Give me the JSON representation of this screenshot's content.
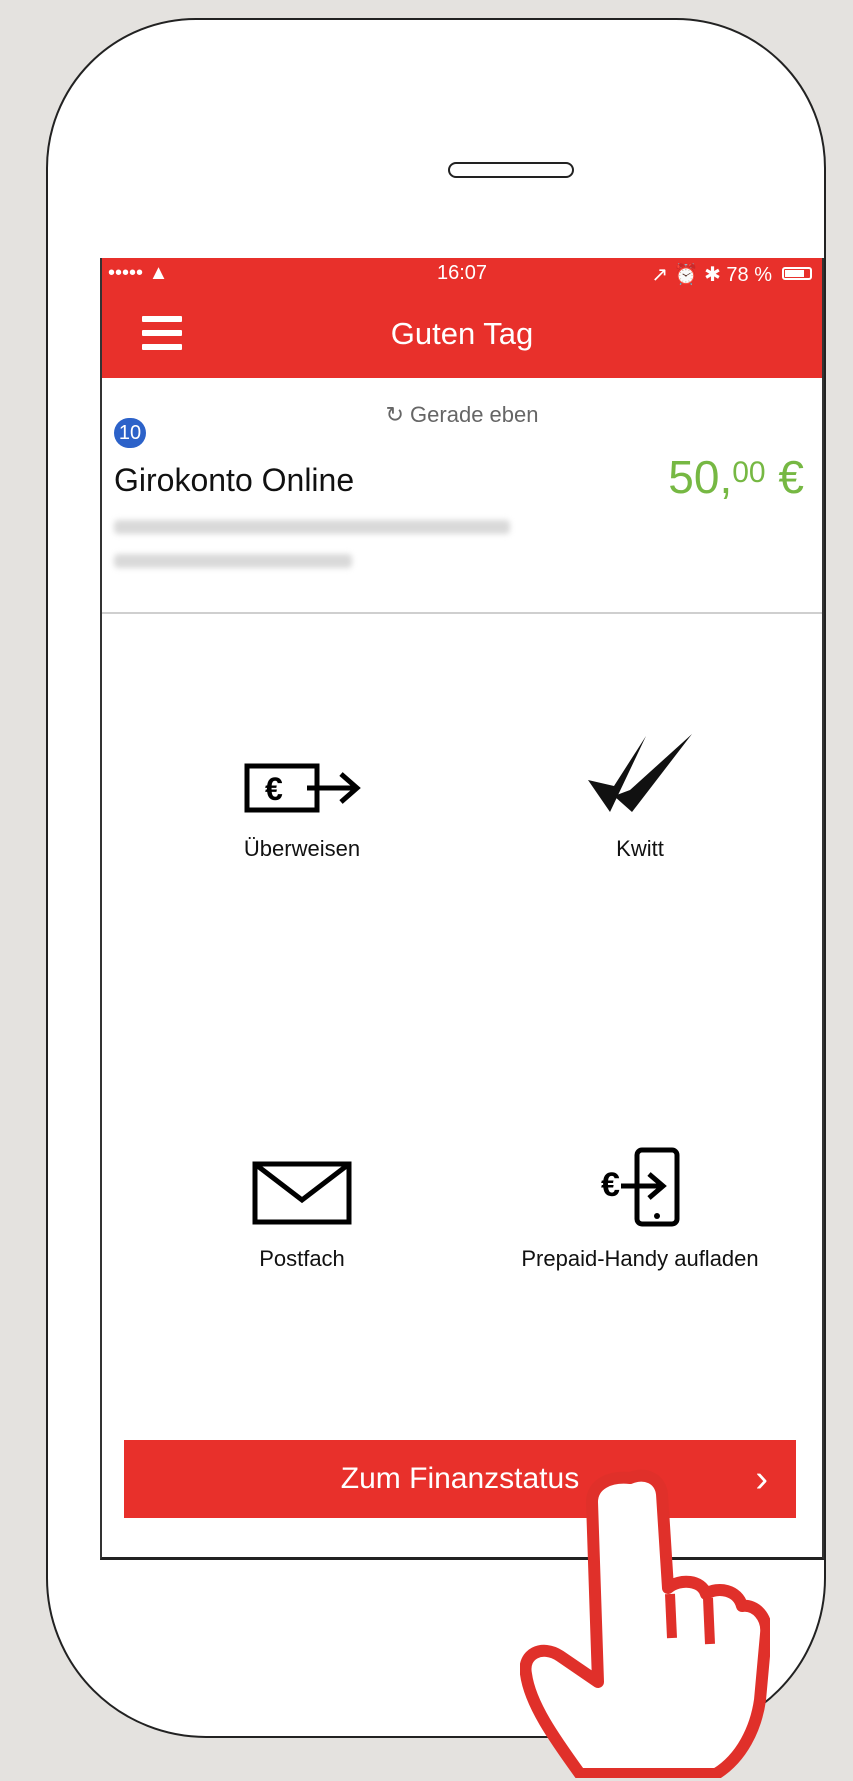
{
  "statusbar": {
    "signal": "•••••  ▲",
    "time": "16:07",
    "indicators": "↗  ⏰  ✱  78 %",
    "battery_level": 0.78
  },
  "header": {
    "title": "Guten Tag"
  },
  "account": {
    "refresh_label": "↻ Gerade eben",
    "badge": "10",
    "name": "Girokonto Online",
    "balance_main": "50,",
    "balance_cents": "00",
    "balance_currency": " €"
  },
  "actions": {
    "transfer": "Überweisen",
    "kwitt": "Kwitt",
    "mailbox": "Postfach",
    "topup": "Prepaid-Handy aufladen"
  },
  "cta": {
    "label": "Zum Finanzstatus",
    "chevron": "›"
  },
  "colors": {
    "brand_red": "#e8302b",
    "balance_green": "#76b843",
    "badge_blue": "#2c62c9"
  },
  "icons": {
    "menu": "hamburger-icon",
    "transfer": "euro-transfer-icon",
    "kwitt": "double-check-icon",
    "mailbox": "envelope-icon",
    "topup": "phone-topup-icon",
    "hand": "tapping-hand-icon"
  }
}
